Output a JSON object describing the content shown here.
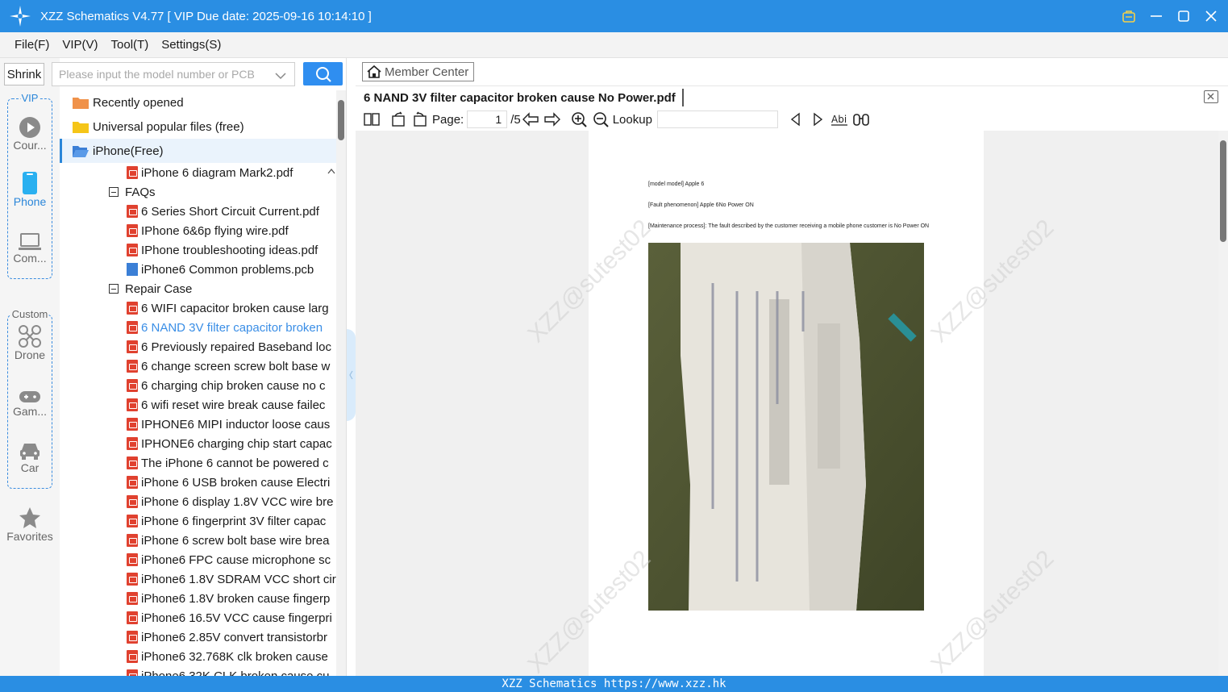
{
  "window": {
    "title": "XZZ Schematics V4.77 [ VIP Due date: 2025-09-16 10:14:10 ]"
  },
  "menu": [
    "File(F)",
    "VIP(V)",
    "Tool(T)",
    "Settings(S)"
  ],
  "rail": {
    "shrink_label": "Shrink",
    "vip_group_label": "VIP",
    "custom_group_label": "Custom",
    "items": {
      "course": "Cour...",
      "phone": "Phone",
      "computer": "Com...",
      "drone": "Drone",
      "game": "Gam...",
      "car": "Car",
      "favorites": "Favorites"
    }
  },
  "search": {
    "placeholder": "Please input the model number or PCB"
  },
  "tree": {
    "roots": [
      "Recently opened",
      "Universal popular files (free)",
      "iPhone(Free)"
    ],
    "top_file": "iPhone 6 diagram Mark2.pdf",
    "faqs_label": "FAQs",
    "faqs": [
      {
        "type": "pdf",
        "name": "6 Series Short Circuit Current.pdf"
      },
      {
        "type": "pdf",
        "name": "IPhone 6&6p flying wire.pdf"
      },
      {
        "type": "pdf",
        "name": "IPhone troubleshooting ideas.pdf"
      },
      {
        "type": "pcb",
        "name": "iPhone6 Common problems.pcb"
      }
    ],
    "repair_label": "Repair Case",
    "repair_cases": [
      "6  WIFI capacitor broken cause larg",
      "6 NAND 3V filter capacitor broken",
      "6 Previously repaired Baseband loc",
      "6 change screen screw bolt base w",
      "6 charging chip broken cause no c",
      "6 wifi reset wire break  cause failec",
      "IPHONE6 MIPI inductor loose caus",
      "IPHONE6 charging chip start capac",
      "The iPhone 6 cannot be powered c",
      "iPhone 6 USB broken cause Electri",
      "iPhone 6 display 1.8V VCC wire bre",
      "iPhone 6 fingerprint 3V filter capac",
      "iPhone 6 screw bolt base wire brea",
      "iPhone6  FPC cause microphone sc",
      "iPhone6 1.8V SDRAM VCC short cir",
      "iPhone6 1.8V broken cause fingerp",
      "iPhone6 16.5V VCC cause fingerpri",
      "iPhone6 2.85V convert transistorbr",
      "iPhone6 32.768K clk broken cause",
      "iPhone6 32K CLK broken cause cu"
    ],
    "active_index": 1
  },
  "content": {
    "member_center": "Member Center",
    "tab_title": "6 NAND 3V filter capacitor broken cause No Power.pdf",
    "toolbar": {
      "page_label": "Page:",
      "page_value": "1",
      "page_total": "/5",
      "lookup_label": "Lookup",
      "lookup_value": ""
    },
    "pdf": {
      "line1": "[model model] Apple 6",
      "line2": "[Fault phenomenon] Apple 6No Power ON",
      "line3": "[Maintenance process]: The fault described by the customer receiving a mobile phone customer is No Power ON"
    },
    "watermark": "XZZ@sutest02"
  },
  "status": "XZZ Schematics https://www.xzz.hk",
  "colors": {
    "accent": "#2a8ee3",
    "link": "#3a8ee6",
    "pdf_icon": "#e0412f"
  }
}
